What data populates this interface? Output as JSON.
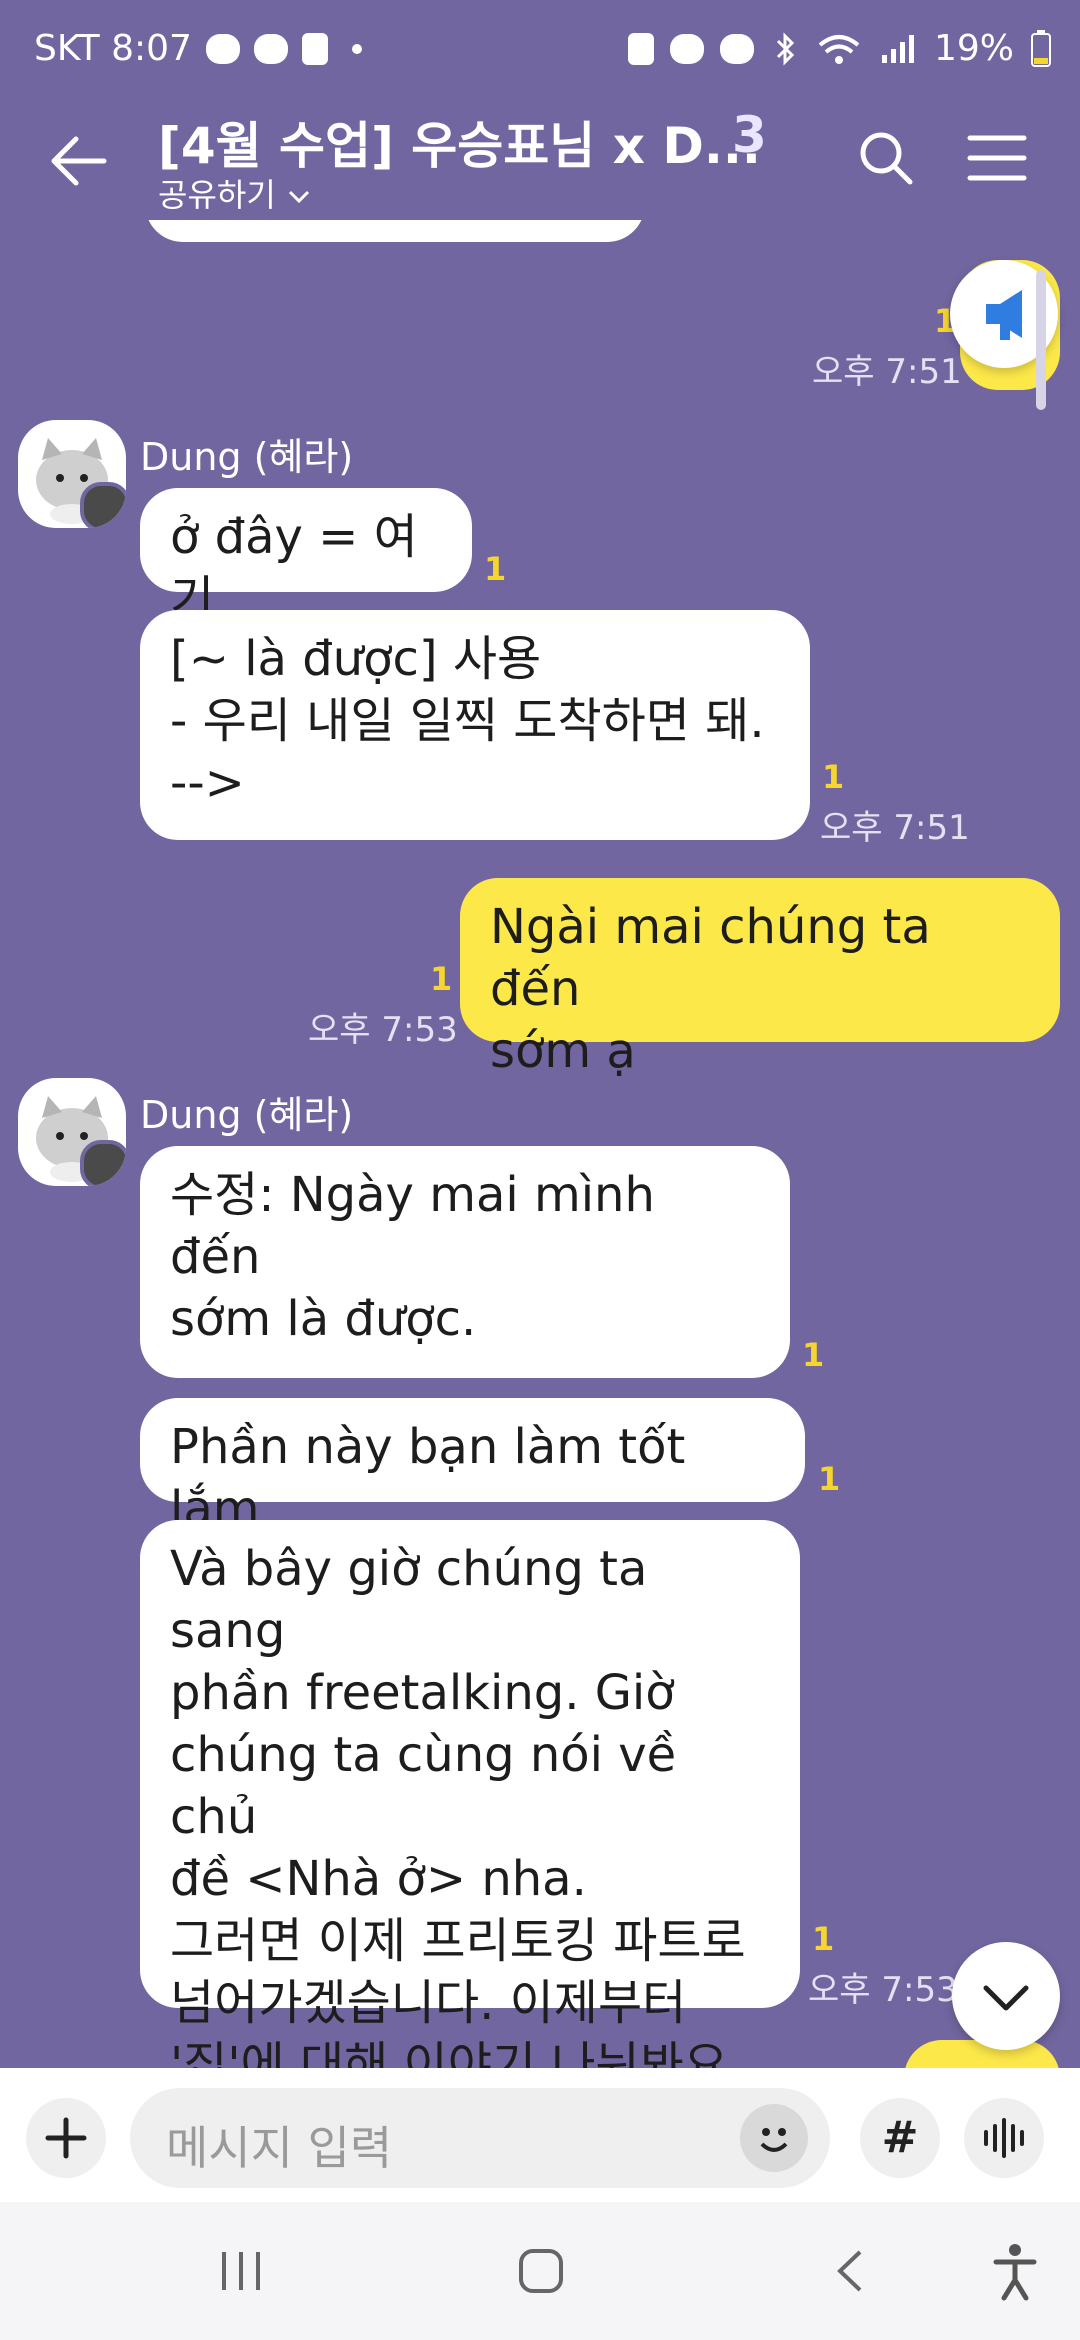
{
  "status": {
    "carrier_time": "SKT 8:07",
    "battery": "19%"
  },
  "header": {
    "title": "[4월 수업] 우승표님 x D...",
    "member_count": "3",
    "share_label": "공유하기"
  },
  "messages": [
    {
      "sender": "",
      "text": "",
      "unread": "1",
      "time": "오후 7:51"
    },
    {
      "sender": "Dung (혜라)",
      "text": "ở đây = 여기",
      "unread": "1"
    },
    {
      "text": "[~ là được] 사용\n- 우리 내일 일찍 도착하면 돼.\n-->",
      "unread": "1",
      "time": "오후 7:51"
    },
    {
      "text": "Ngài mai chúng ta đến\nsớm ạ",
      "unread": "1",
      "time": "오후 7:53"
    },
    {
      "sender": "Dung (혜라)",
      "text": "수정: Ngày mai mình đến\nsớm là được.",
      "unread": "1"
    },
    {
      "text": "Phần này bạn làm tốt lắm",
      "unread": "1"
    },
    {
      "text": "Và bây giờ chúng ta sang\nphần freetalking. Giờ\nchúng ta cùng nói về chủ\nđề <Nhà ở> nha.\n그러면 이제 프리토킹 파트로\n넘어가겠습니다. 이제부터\n'집'에 대해 이야기 나눠봐요.",
      "unread": "1",
      "time": "오후 7:53"
    }
  ],
  "input": {
    "placeholder": "메시지 입력",
    "hash_label": "#"
  },
  "colors": {
    "background": "#7266a0",
    "my_bubble": "#fde84a",
    "unread": "#f6d52f"
  }
}
